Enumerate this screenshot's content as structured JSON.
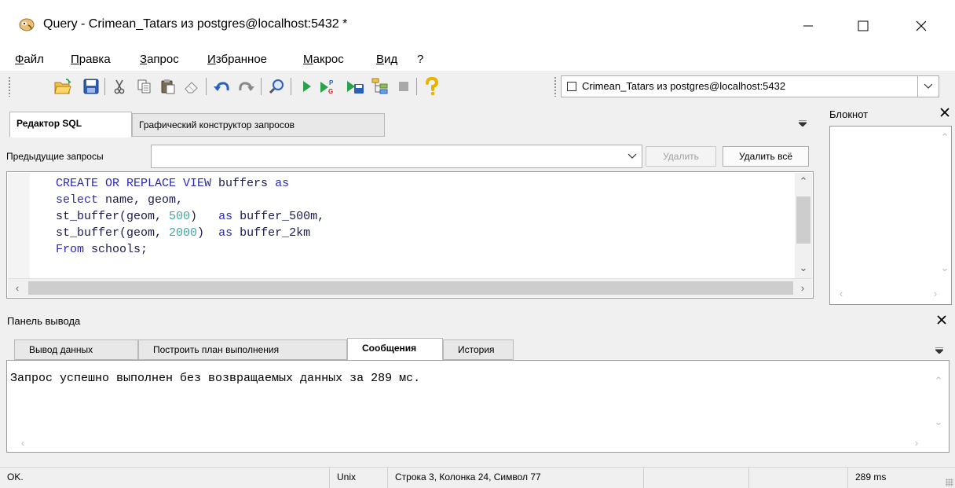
{
  "window": {
    "title": "Query - Crimean_Tatars из postgres@localhost:5432 *"
  },
  "menu": [
    {
      "id": "file",
      "label": "Файл"
    },
    {
      "id": "edit",
      "label": "Правка"
    },
    {
      "id": "query",
      "label": "Запрос"
    },
    {
      "id": "favourites",
      "label": "Избранное"
    },
    {
      "id": "macros",
      "label": "Макрос"
    },
    {
      "id": "view",
      "label": "Вид"
    },
    {
      "id": "help",
      "label": "?"
    }
  ],
  "toolbar": {
    "icons": [
      "open-file-icon",
      "save-icon",
      "cut-icon",
      "copy-icon",
      "paste-icon",
      "clear-icon",
      "undo-icon",
      "redo-icon",
      "find-icon",
      "execute-icon",
      "execute-pgscript-icon",
      "execute-to-file-icon",
      "explain-icon",
      "stop-icon",
      "help-icon"
    ],
    "connection": "Crimean_Tatars из postgres@localhost:5432"
  },
  "editor": {
    "tabs": [
      {
        "label": "Редактор SQL",
        "active": true
      },
      {
        "label": "Графический конструктор запросов",
        "active": false
      }
    ],
    "history_label": "Предыдущие запросы",
    "history_value": "",
    "delete_label": "Удалить",
    "delete_all_label": "Удалить всё",
    "code_lines": [
      [
        {
          "t": "CREATE OR REPLACE VIEW ",
          "c": "kw"
        },
        {
          "t": "buffers ",
          "c": "id"
        },
        {
          "t": "as",
          "c": "kw"
        }
      ],
      [
        {
          "t": "select ",
          "c": "kw"
        },
        {
          "t": "name, geom,",
          "c": "id"
        }
      ],
      [
        {
          "t": "st_buffer(geom, ",
          "c": "id"
        },
        {
          "t": "500",
          "c": "num"
        },
        {
          "t": ")   ",
          "c": "id"
        },
        {
          "t": "as ",
          "c": "kw"
        },
        {
          "t": "buffer_500m,",
          "c": "id"
        }
      ],
      [
        {
          "t": "st_buffer(geom, ",
          "c": "id"
        },
        {
          "t": "2000",
          "c": "num"
        },
        {
          "t": ")  ",
          "c": "id"
        },
        {
          "t": "as ",
          "c": "kw"
        },
        {
          "t": "buffer_2km",
          "c": "id"
        }
      ],
      [
        {
          "t": "From ",
          "c": "kw"
        },
        {
          "t": "schools;",
          "c": "id"
        }
      ]
    ]
  },
  "notepad": {
    "title": "Блокнот"
  },
  "output": {
    "title": "Панель вывода",
    "tabs": [
      {
        "label": "Вывод данных",
        "active": false
      },
      {
        "label": "Построить план выполнения",
        "active": false
      },
      {
        "label": "Сообщения",
        "active": true
      },
      {
        "label": "История",
        "active": false
      }
    ],
    "message": "Запрос успешно выполнен без возвращаемых данных за 289 мс."
  },
  "status": {
    "state": "OK.",
    "line_endings": "Unix",
    "position": "Строка 3, Колонка 24, Символ 77",
    "time": "289 ms"
  }
}
